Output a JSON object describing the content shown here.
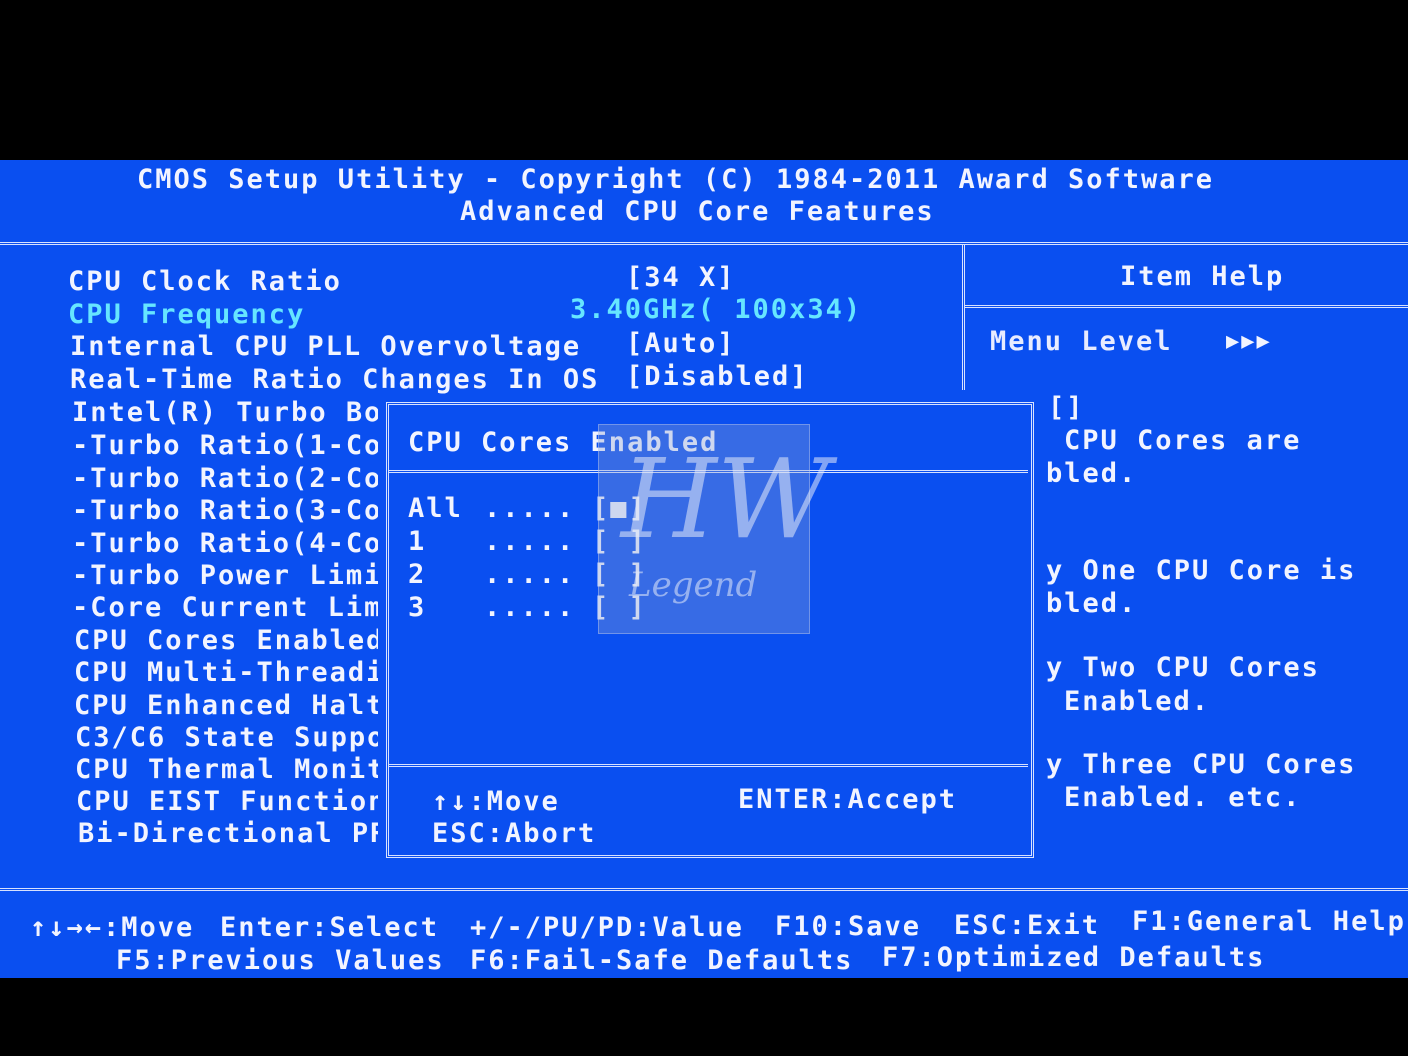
{
  "header": {
    "title": "CMOS Setup Utility - Copyright (C) 1984-2011 Award Software",
    "subtitle": "Advanced CPU Core Features"
  },
  "settings": [
    {
      "label": "CPU Clock Ratio",
      "value": "[34 X]"
    },
    {
      "label": "CPU Frequency",
      "value": "3.40GHz( 100x34)"
    },
    {
      "label": "Internal CPU PLL Overvoltage",
      "value": "[Auto]"
    },
    {
      "label": "Real-Time Ratio Changes In OS",
      "value": "[Disabled]"
    },
    {
      "label": "Intel(R) Turbo Bo",
      "value": ""
    },
    {
      "label": "-Turbo Ratio(1-Co",
      "value": ""
    },
    {
      "label": "-Turbo Ratio(2-Co",
      "value": ""
    },
    {
      "label": "-Turbo Ratio(3-Co",
      "value": ""
    },
    {
      "label": "-Turbo Ratio(4-Co",
      "value": ""
    },
    {
      "label": "-Turbo Power Limi",
      "value": ""
    },
    {
      "label": "-Core Current Lim",
      "value": ""
    },
    {
      "label": "CPU Cores Enabled",
      "value": ""
    },
    {
      "label": "CPU Multi-Threadi",
      "value": ""
    },
    {
      "label": "CPU Enhanced Halt",
      "value": ""
    },
    {
      "label": "C3/C6 State Suppo",
      "value": ""
    },
    {
      "label": "CPU Thermal Monit",
      "value": ""
    },
    {
      "label": "CPU EIST Function",
      "value": ""
    },
    {
      "label": "Bi-Directional PR",
      "value": ""
    }
  ],
  "help": {
    "title": "Item Help",
    "menu_level": "Menu Level",
    "menu_level_arrows": "▶▶▶",
    "lines": [
      "[]",
      "CPU Cores are",
      "bled.",
      "y One CPU Core is",
      "bled.",
      "y Two CPU Cores",
      "Enabled.",
      "y Three CPU Cores",
      "Enabled. etc."
    ]
  },
  "popup": {
    "title": "CPU Cores Enabled",
    "options": [
      {
        "label": "All",
        "dots": ".....",
        "box": "[■]"
      },
      {
        "label": "1",
        "dots": ".....",
        "box": "[ ]"
      },
      {
        "label": "2",
        "dots": ".....",
        "box": "[ ]"
      },
      {
        "label": "3",
        "dots": ".....",
        "box": "[ ]"
      }
    ],
    "move": "↑↓:Move",
    "accept": "ENTER:Accept",
    "abort": "ESC:Abort"
  },
  "watermark": {
    "big": "HW",
    "small": "Legend"
  },
  "footer": {
    "line1": [
      "↑↓→←:Move",
      "Enter:Select",
      "+/-/PU/PD:Value",
      "F10:Save",
      "ESC:Exit",
      "F1:General Help"
    ],
    "line2": [
      "F5:Previous Values",
      "F6:Fail-Safe Defaults",
      "F7:Optimized Defaults"
    ]
  }
}
